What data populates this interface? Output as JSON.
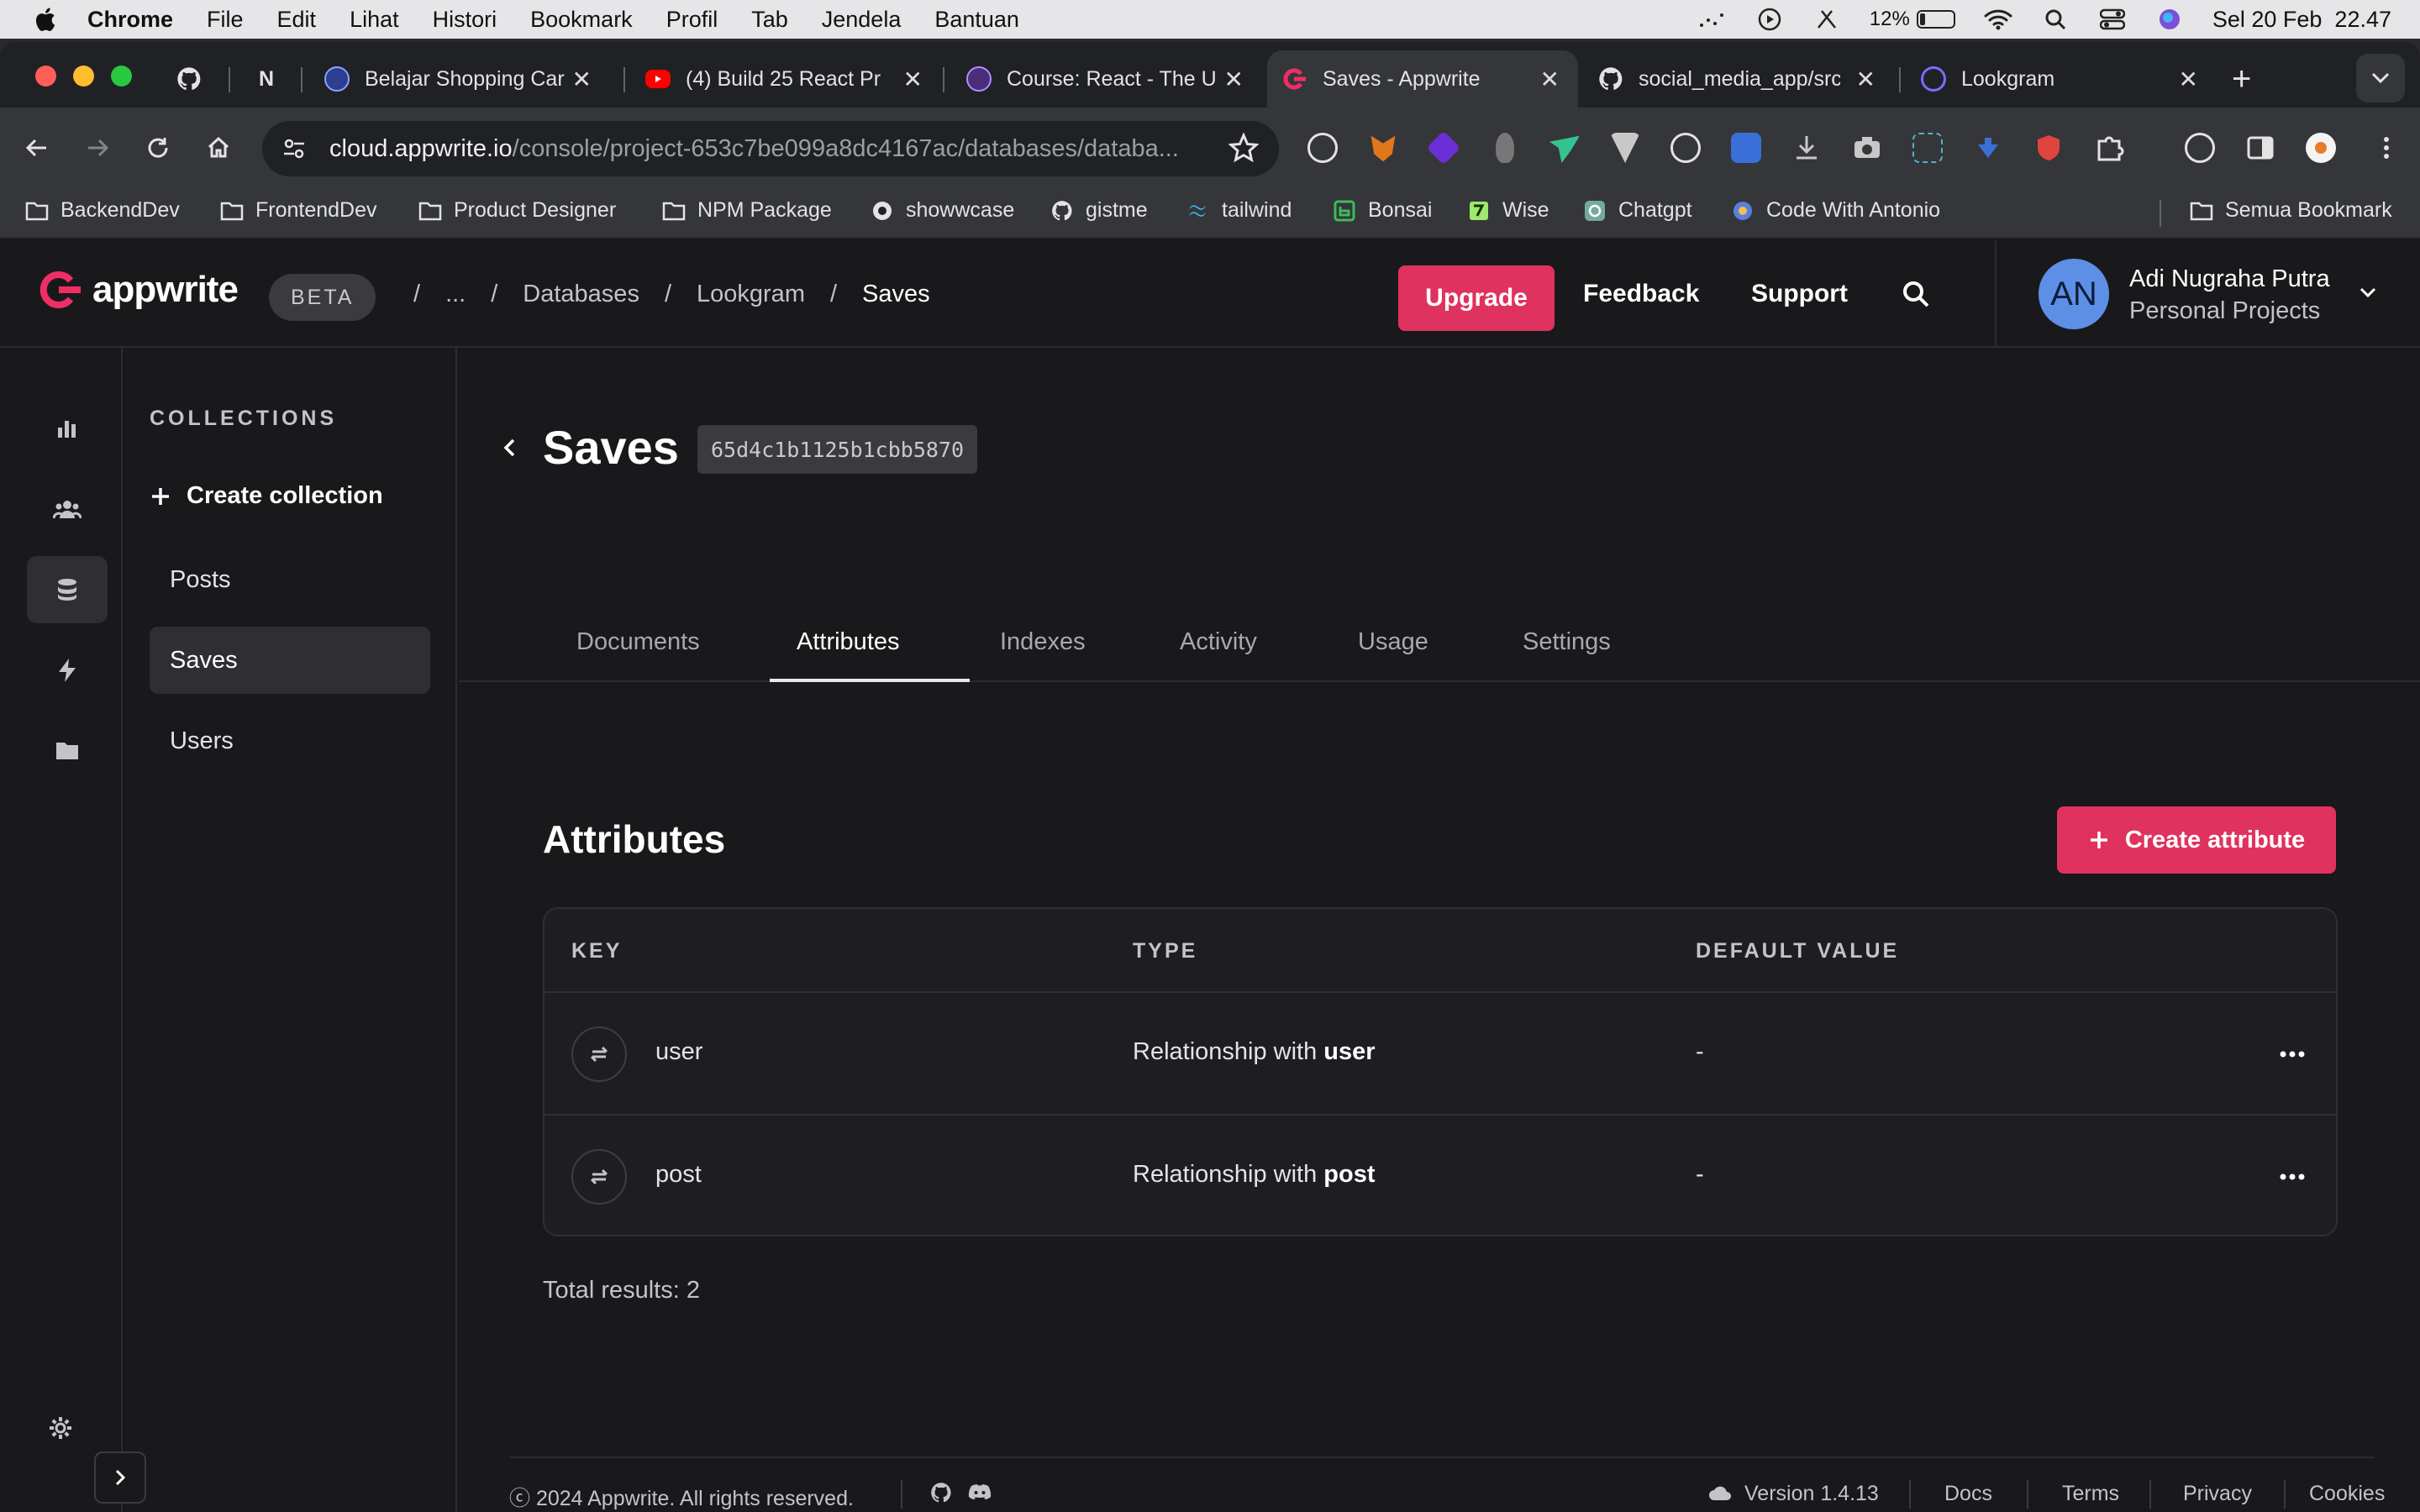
{
  "menubar": {
    "app_name": "Chrome",
    "items": [
      "File",
      "Edit",
      "Lihat",
      "Histori",
      "Bookmark",
      "Profil",
      "Tab",
      "Jendela",
      "Bantuan"
    ],
    "battery_percent": "12%",
    "datetime": "Sel 20 Feb  22.47"
  },
  "tabs": [
    {
      "title": "",
      "icon": "github-icon"
    },
    {
      "title": "N",
      "icon": "notion-icon"
    },
    {
      "title": "Belajar Shopping Car",
      "icon": "site-icon"
    },
    {
      "title": "(4) Build 25 React Pr",
      "icon": "youtube-icon"
    },
    {
      "title": "Course: React - The U",
      "icon": "course-icon"
    },
    {
      "title": "Saves - Appwrite",
      "icon": "appwrite-icon",
      "active": true
    },
    {
      "title": "social_media_app/src",
      "icon": "github-icon"
    },
    {
      "title": "Lookgram",
      "icon": "lookgram-icon"
    }
  ],
  "omnibox": {
    "host": "cloud.appwrite.io",
    "path": "/console/project-653c7be099a8dc4167ac/databases/databa..."
  },
  "bookmarks": [
    {
      "label": "BackendDev",
      "icon": "folder-icon"
    },
    {
      "label": "FrontendDev",
      "icon": "folder-icon"
    },
    {
      "label": "Product Designer",
      "icon": "folder-icon"
    },
    {
      "label": "NPM Package",
      "icon": "folder-icon"
    },
    {
      "label": "showwcase",
      "icon": "showwcase-icon"
    },
    {
      "label": "gistme",
      "icon": "github-icon"
    },
    {
      "label": "tailwind",
      "icon": "tailwind-icon"
    },
    {
      "label": "Bonsai",
      "icon": "bonsai-icon"
    },
    {
      "label": "Wise",
      "icon": "wise-icon"
    },
    {
      "label": "Chatgpt",
      "icon": "chatgpt-icon"
    },
    {
      "label": "Code With Antonio",
      "icon": "code-icon"
    }
  ],
  "all_bookmarks": "Semua Bookmark",
  "header": {
    "logo_text": "appwrite",
    "beta": "BETA",
    "breadcrumbs": [
      "...",
      "Databases",
      "Lookgram",
      "Saves"
    ],
    "upgrade": "Upgrade",
    "feedback": "Feedback",
    "support": "Support",
    "avatar_initials": "AN",
    "user_name": "Adi Nugraha Putra",
    "org_name": "Personal Projects"
  },
  "collections": {
    "heading": "COLLECTIONS",
    "create_label": "Create collection",
    "items": [
      "Posts",
      "Saves",
      "Users"
    ]
  },
  "main": {
    "title": "Saves",
    "collection_id": "65d4c1b1125b1cbb5870",
    "tabs": [
      "Documents",
      "Attributes",
      "Indexes",
      "Activity",
      "Usage",
      "Settings"
    ],
    "active_tab": "Attributes",
    "section_title": "Attributes",
    "create_attribute": "Create attribute",
    "columns": [
      "KEY",
      "TYPE",
      "DEFAULT VALUE"
    ],
    "rows": [
      {
        "key": "user",
        "type_prefix": "Relationship with",
        "type_target": "user",
        "default": "-"
      },
      {
        "key": "post",
        "type_prefix": "Relationship with",
        "type_target": "post",
        "default": "-"
      }
    ],
    "total": "Total results: 2"
  },
  "footer": {
    "copyright": "ⓒ 2024 Appwrite. All rights reserved.",
    "version": "Version 1.4.13",
    "links": [
      "Docs",
      "Terms",
      "Privacy",
      "Cookies"
    ]
  },
  "colors": {
    "accent": "#e0325e",
    "background": "#19191c",
    "avatar": "#5e8fe6"
  }
}
